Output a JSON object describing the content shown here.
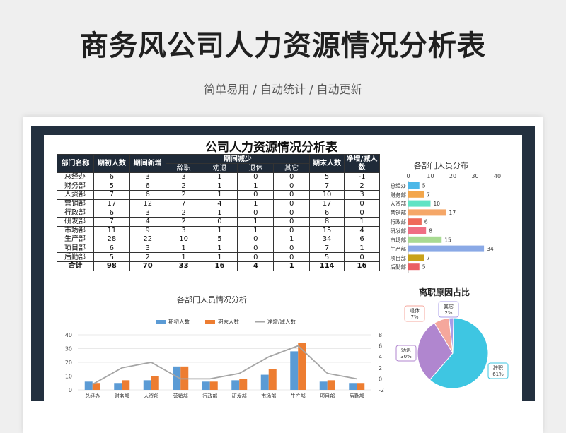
{
  "header": {
    "title": "商务风公司人力资源情况分析表",
    "subtitle": "简单易用 / 自动统计 / 自动更新"
  },
  "sheet": {
    "title": "公司人力资源情况分析表",
    "columns": {
      "dept": "部门名称",
      "start": "期初人数",
      "new": "期间新增",
      "decrease": "期间减少",
      "resign": "辞职",
      "dismiss": "劝退",
      "retire": "退休",
      "other": "其它",
      "end": "期末人数",
      "net": "净增/减人数"
    },
    "rows": [
      {
        "dept": "总经办",
        "start": "6",
        "new": "3",
        "resign": "3",
        "dismiss": "1",
        "retire": "0",
        "other": "0",
        "end": "5",
        "net": "-1"
      },
      {
        "dept": "财务部",
        "start": "5",
        "new": "6",
        "resign": "2",
        "dismiss": "1",
        "retire": "1",
        "other": "0",
        "end": "7",
        "net": "2"
      },
      {
        "dept": "人资部",
        "start": "7",
        "new": "6",
        "resign": "2",
        "dismiss": "1",
        "retire": "0",
        "other": "0",
        "end": "10",
        "net": "3"
      },
      {
        "dept": "营销部",
        "start": "17",
        "new": "12",
        "resign": "7",
        "dismiss": "4",
        "retire": "1",
        "other": "0",
        "end": "17",
        "net": "0"
      },
      {
        "dept": "行政部",
        "start": "6",
        "new": "3",
        "resign": "2",
        "dismiss": "1",
        "retire": "0",
        "other": "0",
        "end": "6",
        "net": "0"
      },
      {
        "dept": "研发部",
        "start": "7",
        "new": "4",
        "resign": "2",
        "dismiss": "0",
        "retire": "1",
        "other": "0",
        "end": "8",
        "net": "1"
      },
      {
        "dept": "市场部",
        "start": "11",
        "new": "9",
        "resign": "3",
        "dismiss": "1",
        "retire": "1",
        "other": "0",
        "end": "15",
        "net": "4"
      },
      {
        "dept": "生产部",
        "start": "28",
        "new": "22",
        "resign": "10",
        "dismiss": "5",
        "retire": "0",
        "other": "1",
        "end": "34",
        "net": "6"
      },
      {
        "dept": "项目部",
        "start": "6",
        "new": "3",
        "resign": "1",
        "dismiss": "1",
        "retire": "0",
        "other": "0",
        "end": "7",
        "net": "1"
      },
      {
        "dept": "后勤部",
        "start": "5",
        "new": "2",
        "resign": "1",
        "dismiss": "1",
        "retire": "0",
        "other": "0",
        "end": "5",
        "net": "0"
      }
    ],
    "total": {
      "dept": "合计",
      "start": "98",
      "new": "70",
      "resign": "33",
      "dismiss": "16",
      "retire": "4",
      "other": "1",
      "end": "114",
      "net": "16"
    }
  },
  "chart_data": [
    {
      "type": "bar",
      "orientation": "horizontal",
      "title": "各部门人员分布",
      "categories": [
        "总经办",
        "财务部",
        "人资部",
        "营销部",
        "行政部",
        "研发部",
        "市场部",
        "生产部",
        "项目部",
        "后勤部"
      ],
      "values": [
        5,
        7,
        10,
        17,
        6,
        8,
        15,
        34,
        7,
        5
      ],
      "xlim": [
        0,
        40
      ],
      "xticks": [
        0,
        10,
        20,
        30,
        40
      ],
      "colors": [
        "#4cb8e8",
        "#f3a64b",
        "#5fe3c4",
        "#f5a768",
        "#ef6a5a",
        "#ef6e83",
        "#a8da92",
        "#8aa9e6",
        "#c9a21a",
        "#ea5e63"
      ]
    },
    {
      "type": "pie",
      "title": "离职原因占比",
      "labels": [
        "辞职",
        "劝退",
        "退休",
        "其它"
      ],
      "values": [
        61,
        30,
        7,
        2
      ],
      "display": [
        "辞职 61%",
        "劝退 30%",
        "退休 7%",
        "其它 2%"
      ],
      "colors": [
        "#3ec6e2",
        "#b086cf",
        "#f5a79c",
        "#a89ce8"
      ]
    },
    {
      "type": "bar",
      "title": "各部门人员情况分析",
      "categories": [
        "总经办",
        "财务部",
        "人资部",
        "营销部",
        "行政部",
        "研发部",
        "市场部",
        "生产部",
        "项目部",
        "后勤部"
      ],
      "series": [
        {
          "name": "期初人数",
          "type": "bar",
          "values": [
            6,
            5,
            7,
            17,
            6,
            7,
            11,
            28,
            6,
            5
          ],
          "color": "#5b9bd5"
        },
        {
          "name": "期末人数",
          "type": "bar",
          "values": [
            5,
            7,
            10,
            17,
            6,
            8,
            15,
            34,
            7,
            5
          ],
          "color": "#ed7d31"
        },
        {
          "name": "净增/减人数",
          "type": "line",
          "axis": "right",
          "values": [
            -1,
            2,
            3,
            0,
            0,
            1,
            4,
            6,
            1,
            0
          ],
          "color": "#a5a5a5"
        }
      ],
      "ylim": [
        0,
        40
      ],
      "yticks": [
        0,
        10,
        20,
        30,
        40
      ],
      "y2lim": [
        -2,
        8
      ],
      "y2ticks": [
        -2,
        0,
        2,
        4,
        6,
        8
      ]
    }
  ]
}
